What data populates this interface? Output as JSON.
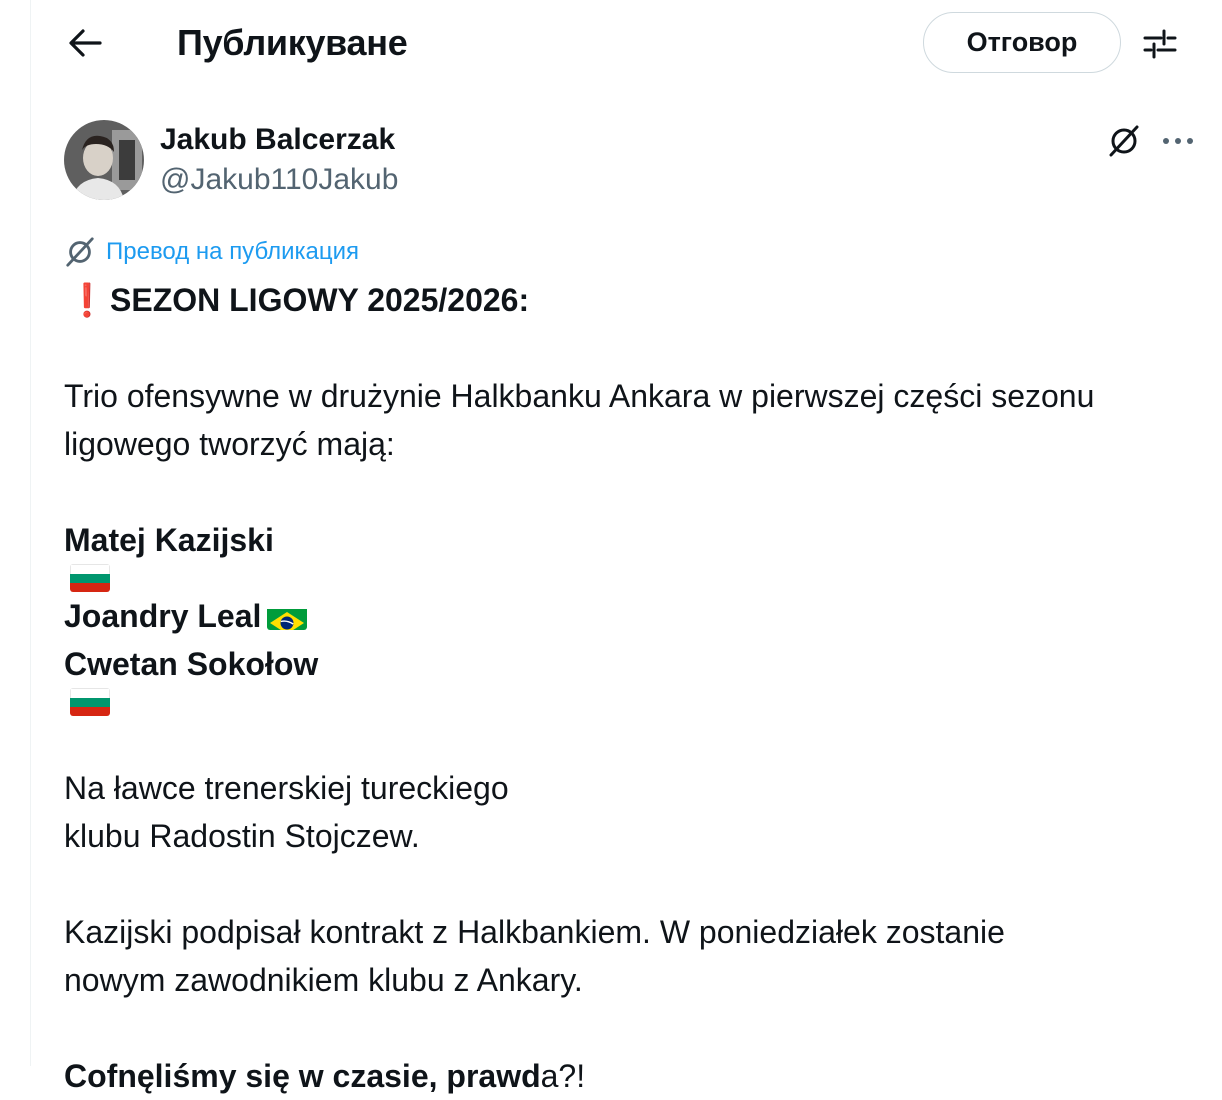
{
  "header": {
    "title": "Публикуване",
    "reply_label": "Отговор"
  },
  "author": {
    "name": "Jakub Balcerzak",
    "handle": "@Jakub110Jakub"
  },
  "translate_label": "Превод на публикация",
  "tweet": {
    "headline": "SEZON LIGOWY 2025/2026:",
    "paragraph1": [
      "Trio ofensywne w drużynie Halkbanku Ankara w pierwszej części sezonu",
      "ligowego tworzyć mają:"
    ],
    "players": [
      {
        "name": "Matej Kazijski",
        "flag": "bulgaria-flag"
      },
      {
        "name": "Joandry Leal",
        "flag": "brazil-flag"
      },
      {
        "name": "Cwetan Sokołow",
        "flag": "bulgaria-flag"
      }
    ],
    "paragraph2": [
      "Na ławce trenerskiej tureckiego",
      "klubu Radostin Stojczew."
    ],
    "paragraph3": [
      "Kazijski podpisał kontrakt z Halkbankiem. W poniedziałek zostanie",
      "nowym zawodnikiem klubu z Ankary."
    ],
    "closing_bold": "Cofnęliśmy się w czasie, prawd",
    "closing_rest": "a?!"
  },
  "colors": {
    "link": "#1d9bf0",
    "secondary_text": "#536471",
    "exclamation": "#e0245e",
    "border": "#cfd9de"
  }
}
